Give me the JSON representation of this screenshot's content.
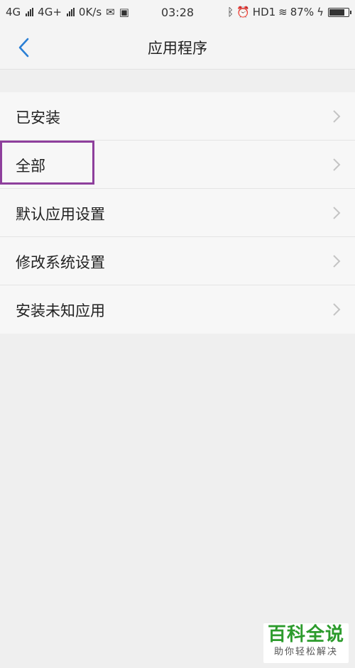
{
  "status_bar": {
    "network1": "4G",
    "network2": "4G+",
    "speed": "0K/s",
    "time": "03:28",
    "hd": "HD1",
    "battery": "87%"
  },
  "header": {
    "title": "应用程序",
    "back_icon": "chevron-left-icon"
  },
  "menu": {
    "items": [
      {
        "label": "已安装"
      },
      {
        "label": "全部"
      },
      {
        "label": "默认应用设置"
      },
      {
        "label": "修改系统设置"
      },
      {
        "label": "安装未知应用"
      }
    ]
  },
  "watermark": {
    "main": "百科全说",
    "sub": "助你轻松解决"
  },
  "colors": {
    "accent": "#2a7fd4",
    "highlight": "#8e3f9c",
    "watermark": "#2c9b2c"
  }
}
